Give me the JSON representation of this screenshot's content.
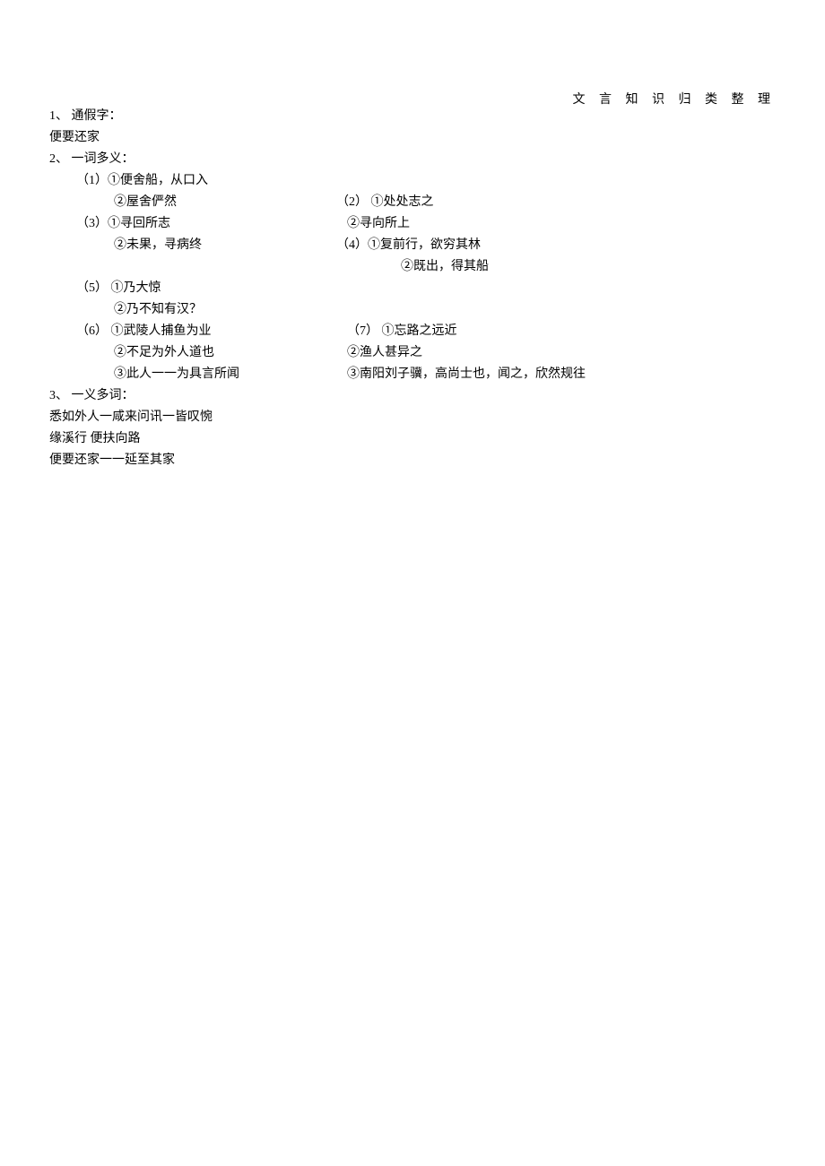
{
  "header": "文 言 知 识 归 类 整 理",
  "section1": {
    "heading": "1、 通假字：",
    "line": "便要还家"
  },
  "section2": {
    "heading": "2、 一词多义：",
    "item1": {
      "a": "（1）①便舍船，从口入",
      "b": "②屋舍俨然"
    },
    "item2": {
      "a": "（2）  ①处处志之",
      "b": "②寻向所上"
    },
    "item3": {
      "a": "（3）①寻回所志",
      "b": "②未果，寻病终"
    },
    "item4": {
      "a": "（4）①复前行，欲穷其林",
      "b": "②既出，得其船"
    },
    "item5": {
      "a": "（5）      ①乃大惊",
      "b": "②乃不知有汉？"
    },
    "item6": {
      "a": "（6）      ①武陵人捕鱼为业",
      "b": "②不足为外人道也",
      "c": "③此人一一为具言所闻"
    },
    "item7": {
      "a": "（7）  ①忘路之远近",
      "b": "②渔人甚异之",
      "c": "③南阳刘子骥，高尚士也，闻之，欣然规往"
    }
  },
  "section3": {
    "heading": "3、 一义多词：",
    "line1": "悉如外人一咸来问讯一皆叹惋",
    "line2": "缘溪行  便扶向路",
    "line3": "便要还家一一延至其家"
  }
}
